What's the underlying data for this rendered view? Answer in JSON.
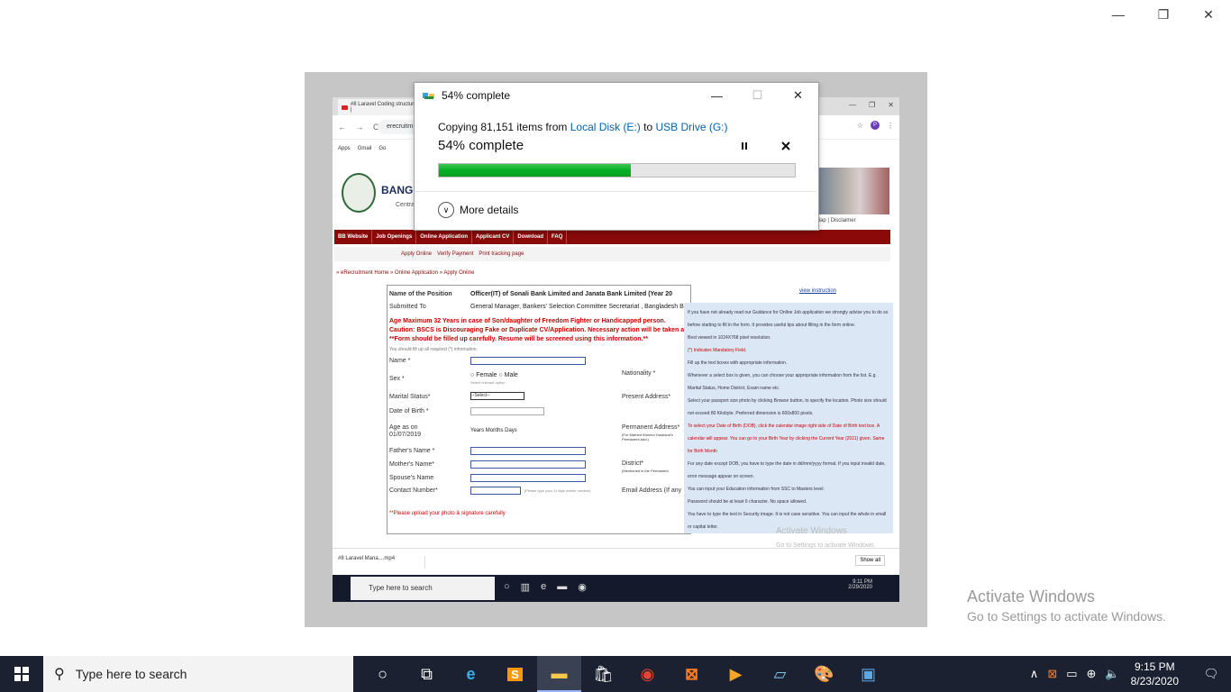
{
  "outer_window": {
    "controls": {
      "minimize": "—",
      "restore": "❐",
      "close": "✕"
    }
  },
  "watermark": {
    "line1": "Activate Windows",
    "line2": "Go to Settings to activate Windows."
  },
  "photo": {
    "tab_title": "#8 Laravel Coding structure |",
    "browser_controls": {
      "min": "—",
      "restore": "❐",
      "close": "✕"
    },
    "nav": "← → C",
    "url": "erecruitm",
    "avatar": "P",
    "bookmarks": [
      "Apps",
      "Gmail",
      "Go"
    ],
    "bank_title": "BANGLA",
    "bank_sub": "Centra",
    "header_links": "Map | Disclaimer",
    "menu": [
      "BB Website",
      "Job Openings",
      "Online Application",
      "Applicant CV",
      "Download",
      "FAQ"
    ],
    "submenu": [
      "Apply Online",
      "Verify Payment",
      "Print tracking page"
    ],
    "breadcrumb": "» eRecruitment Home  » Online Application  » Apply Online",
    "view_instruction": "view instruction",
    "form": {
      "position_label": "Name of the Position",
      "position_value": "Officer(IT) of Sonali Bank Limited and Janata Bank Limited (Year 20",
      "submitted_label": "Submitted To",
      "submitted_value": "General Manager, Bankers' Selection Committee Secretariat , Bangladesh B",
      "warn1": "Age Maximum 32 Years in case of Son/daughter of Freedom Fighter or Handicapped person.",
      "warn2": "Caution: BSCS is Discouraging Fake or Duplicate CV/Application. Necessary action will be taken against these",
      "warn3": "**Form should be filled up carefully. Resume will be screened using this information.**",
      "required_note": "You should fill up all required (*) information.",
      "name": "Name *",
      "sex": "Sex *",
      "female": "Female",
      "male": "Male",
      "sex_hint": "Select relevant option",
      "marital": "Marital Status*",
      "marital_value": "--Select--",
      "dob": "Date of Birth *",
      "age_as_on": "Age as on",
      "age_date": "01/07/2019",
      "age_value": "Years Months Days",
      "father": "Father's Name *",
      "mother": "Mother's Name*",
      "spouse": "Spouse's Name",
      "contact": "Contact Number*",
      "contact_hint": "[Please type your 11 digit mobile number]",
      "nationality": "Nationality *",
      "present_address": "Present Address*",
      "permanent_address": "Permanent Address*",
      "perm_hint": "(For Married Women Husband's Permanent Add.)",
      "district": "District*",
      "district_hint": "(Mentioned in the Permanent",
      "email": "Email Address (If any",
      "photo_note": "**Please upload your photo & signature carefully"
    },
    "help_lines": [
      "If you have not already read our Guidance for Online Job application we strongly advise you to do so before starting to fill in the form. It provides useful tips about filling in the form online.",
      "Best viewed in 1024X768 pixel resolution.",
      "(*) Indicates Mandatory Field.",
      "Fill up the text boxes with appropriate information.",
      "Whenever a select box is given, you can choose your appropriate information from the list. E.g. Marital Status, Home District, Exam name etc.",
      "Select your passport size photo by clicking Browse button, to specify the location. Photo size should not exceed 80 Kilobyte. Preferred dimension is 600x800 pixels.",
      "To select your Date of Birth (DOB), click the calendar image right side of Date of Birth text box. A calendar will appear. You can go to your Birth Year by clicking the Current Year (2011) given. Same for Birth Month",
      "For any date except DOB, you have to type the date in dd/mm/yyyy format. If you input invalid date, error message appear on screen.",
      "You can input your Education information from SSC to Masters level.",
      "Password should be at least 6 character. No space allowed.",
      "You have to type the text in Security image. It is not case sensitive. You can input the whole in small or capital letter."
    ],
    "download_item": "#8 Laravel Mana....mp4",
    "show_all": "Show all",
    "lt_search": "Type here to search",
    "lt_time": "9:11 PM",
    "lt_date": "2/29/2020",
    "lt_watermark1": "Activate Windows",
    "lt_watermark2": "Go to Settings to activate Windows."
  },
  "dialog": {
    "title": "54% complete",
    "controls": {
      "minimize": "—",
      "maximize": "☐",
      "close": "✕"
    },
    "copying_prefix": "Copying 81,151 items from",
    "source": "Local Disk (E:)",
    "to_word": "to",
    "destination": "USB Drive (G:)",
    "percent_text": "54% complete",
    "progress": 0.54,
    "pause_icon": "pause-icon",
    "cancel_icon": "cancel-icon",
    "more_details": "More details"
  },
  "taskbar": {
    "search_placeholder": "Type here to search",
    "apps": [
      "cortana-icon",
      "task-view-icon",
      "edge-icon",
      "sublime-text-icon",
      "file-explorer-icon",
      "store-icon",
      "chrome-icon",
      "xampp-icon",
      "media-player-icon",
      "notepad-icon",
      "paint-icon",
      "photos-icon"
    ],
    "time": "9:15 PM",
    "date": "8/23/2020"
  },
  "colors": {
    "progress_green": "#06b025",
    "link_blue": "#0063b1",
    "bank_red": "#8a0a0a",
    "taskbar": "#1b2130"
  }
}
